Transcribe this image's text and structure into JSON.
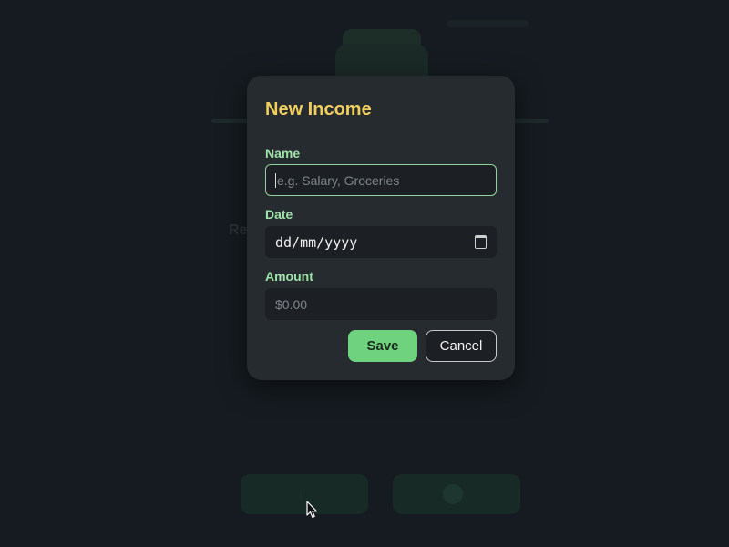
{
  "background": {
    "header_text": "",
    "left_text": "Re",
    "income_button_label": "",
    "expense_button_label": ""
  },
  "modal": {
    "title": "New Income",
    "name": {
      "label": "Name",
      "value": "",
      "placeholder": "e.g. Salary, Groceries"
    },
    "date": {
      "label": "Date",
      "value": "dd/mm/yyyy",
      "icon": "calendar-icon"
    },
    "amount": {
      "label": "Amount",
      "value": "",
      "placeholder": "$0.00"
    },
    "save_label": "Save",
    "cancel_label": "Cancel"
  },
  "colors": {
    "title": "#f1cf5e",
    "labels": "#9fe3a9",
    "save_button": "#6fd27e",
    "focus_border": "#8fd39a",
    "modal_bg": "#262b30",
    "input_bg": "#1c2024"
  }
}
